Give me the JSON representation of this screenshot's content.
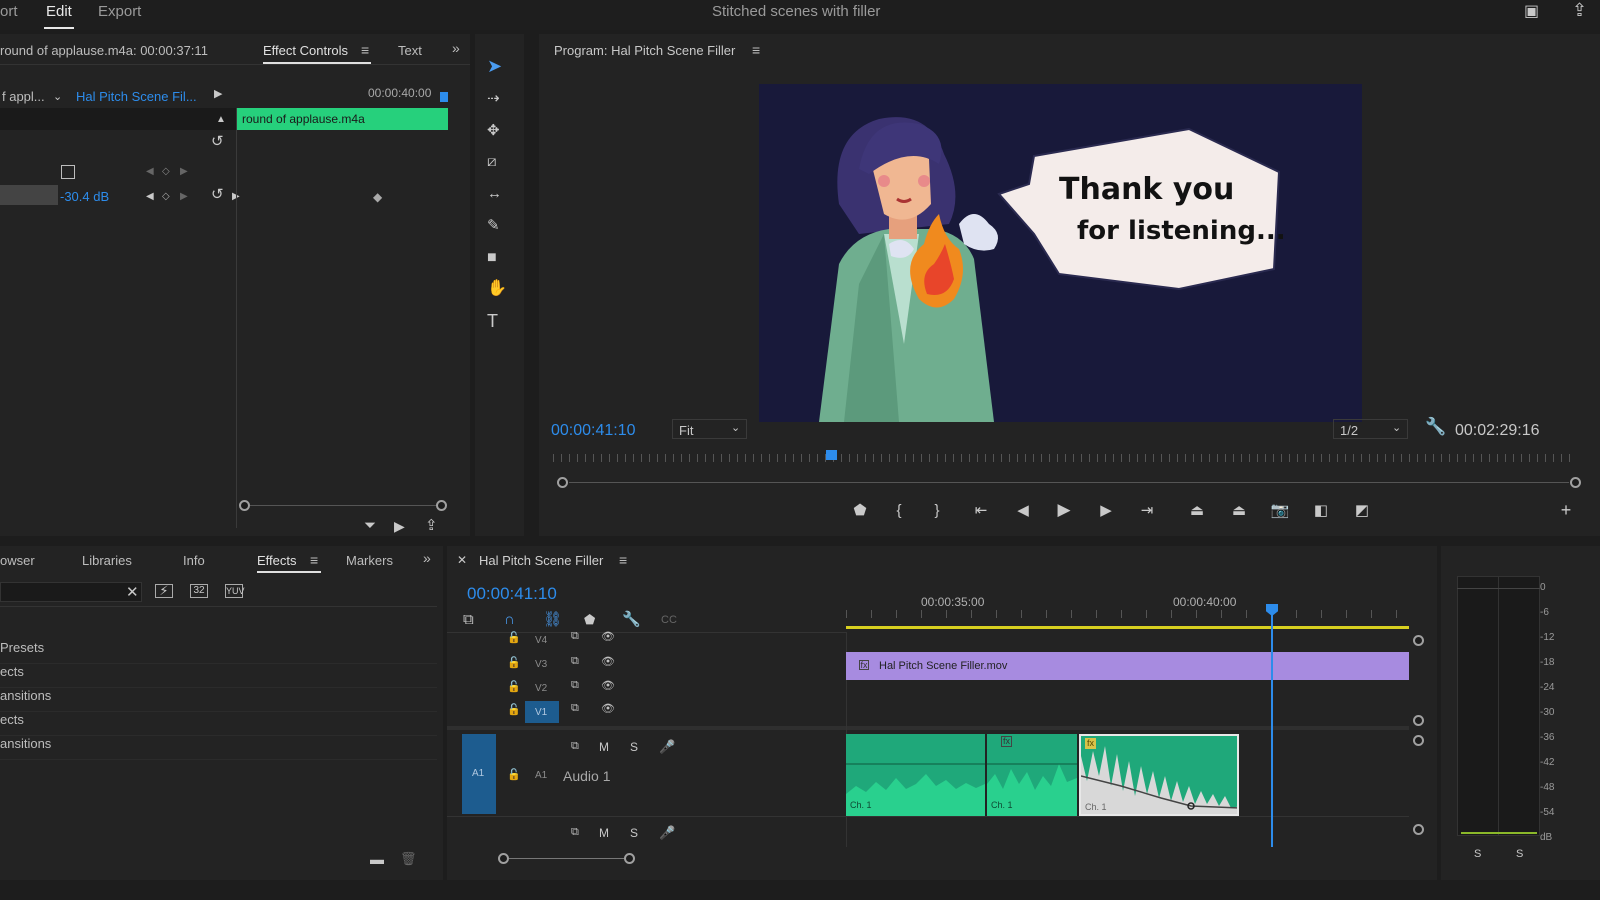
{
  "top_tabs": [
    "ort",
    "Edit",
    "Export"
  ],
  "project_title": "Stitched scenes with filler",
  "effect_controls": {
    "source_label": "round of applause.m4a: 00:00:37:11",
    "tab_active": "Effect Controls",
    "tab_other": "Text",
    "clip_left": "f appl...",
    "sequence_name": "Hal Pitch Scene Fil...",
    "timecode": "00:00:40:00",
    "clip_bar_label": "round of applause.m4a",
    "level_value": "-30.4 dB"
  },
  "effects_panel": {
    "tabs": [
      "owser",
      "Libraries",
      "Info",
      "Effects",
      "Markers"
    ],
    "active_tab": "Effects",
    "tree_items": [
      "Presets",
      "ects",
      "ansitions",
      "ects",
      "ansitions"
    ]
  },
  "program_monitor": {
    "title": "Program: Hal Pitch Scene Filler",
    "playhead_time": "00:00:41:10",
    "fit": "Fit",
    "resolution": "1/2",
    "duration": "00:02:29:16",
    "speech_line1": "Thank you",
    "speech_line2": "for listening..."
  },
  "timeline": {
    "sequence_tab": "Hal Pitch Scene Filler",
    "timecode": "00:00:41:10",
    "ruler_labels": [
      "00:00:35:00",
      "00:00:40:00"
    ],
    "video_tracks": [
      "V4",
      "V3",
      "V2",
      "V1"
    ],
    "audio_tracks": [
      "A1"
    ],
    "source_patch_audio": "A1",
    "audio_track_name": "Audio 1",
    "video_clip_label": "Hal Pitch Scene Filler.mov",
    "audio_channel_label": "Ch. 1",
    "mute_label": "M",
    "solo_label": "S",
    "fx_badge": "fx"
  },
  "audio_meter": {
    "scale": [
      "0",
      "-6",
      "-12",
      "-18",
      "-24",
      "-30",
      "-36",
      "-42",
      "-48",
      "-54",
      "dB"
    ],
    "solo_buttons": [
      "S",
      "S"
    ]
  },
  "colors": {
    "accent_blue": "#2d8ceb",
    "audio_clip_green": "#1fa87a",
    "video_clip_purple": "#a78be0",
    "work_area_yellow": "#d8d020",
    "green_bar": "#26d07c"
  }
}
